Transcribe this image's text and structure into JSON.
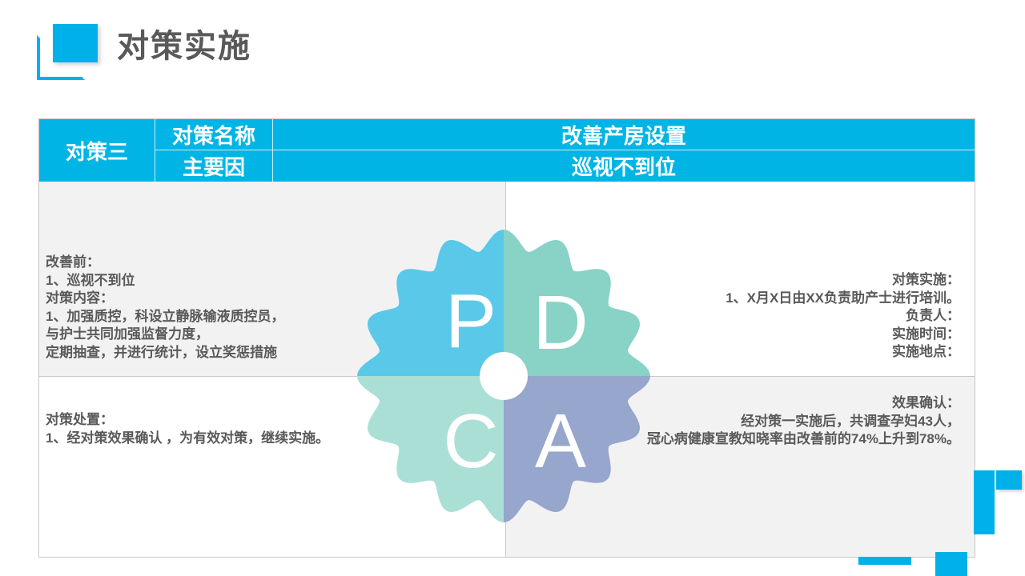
{
  "page": {
    "title": "对策实施"
  },
  "table": {
    "header": {
      "label": "对策三",
      "row1_name": "对策名称",
      "row1_value": "改善产房设置",
      "row2_name": "主要因",
      "row2_value": "巡视不到位"
    },
    "quadrants": {
      "top_left": "改善前：\n1、巡视不到位\n对策内容：\n1、加强质控，科设立静脉输液质控员，\n与护士共同加强监督力度，\n定期抽查，并进行统计，设立奖惩措施",
      "top_right": "对策实施：\n1、X月X日由XX负责助产士进行培训。\n负责人：\n实施时间：\n实施地点：",
      "bottom_left": "对策处置：\n1、经对策效果确认 ，为有效对策，继续实施。",
      "bottom_right": "效果确认：\n经对策一实施后，共调查孕妇43人，\n冠心病健康宣教知晓率由改善前的74%上升到78%。"
    }
  },
  "pdca": {
    "letters": [
      "P",
      "D",
      "C",
      "A"
    ],
    "colors": {
      "p": "#5ac8e8",
      "d": "#88d2c6",
      "c": "#aadfd6",
      "a": "#96a6cc",
      "accent": "#00b5e5"
    }
  }
}
